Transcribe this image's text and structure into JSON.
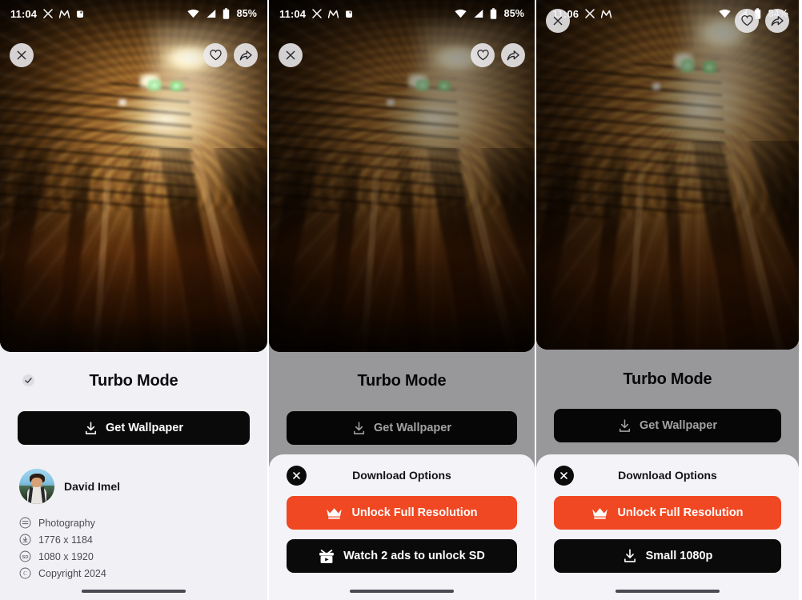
{
  "panels": [
    {
      "id": "panel-initial",
      "status": {
        "time": "11:04",
        "battery": "85%",
        "icons": [
          "x-app-icon",
          "monzo-icon",
          "app-badge-icon",
          "wifi-icon",
          "cellular-signal-icon",
          "battery-icon"
        ]
      },
      "top_actions": {
        "close": "close-icon",
        "favorite": "heart-icon",
        "share": "share-icon"
      },
      "wallpaper_title": "Turbo Mode",
      "get_wallpaper_label": "Get Wallpaper",
      "author": {
        "name": "David Imel",
        "verified": true
      },
      "meta": [
        {
          "icon": "category-icon",
          "text": "Photography"
        },
        {
          "icon": "resolution-icon",
          "text": "1776 x 1184"
        },
        {
          "icon": "sd-icon",
          "text": "1080 x 1920"
        },
        {
          "icon": "copyright-icon",
          "text": "Copyright 2024"
        }
      ],
      "sheet": null,
      "dimmed": false
    },
    {
      "id": "panel-download-options-ads",
      "status": {
        "time": "11:04",
        "battery": "85%",
        "icons": [
          "x-app-icon",
          "monzo-icon",
          "app-badge-icon",
          "wifi-icon",
          "cellular-signal-icon",
          "battery-icon"
        ]
      },
      "top_actions": {
        "close": "close-icon",
        "favorite": "heart-icon",
        "share": "share-icon"
      },
      "wallpaper_title": "Turbo Mode",
      "get_wallpaper_label": "Get Wallpaper",
      "dimmed": true,
      "sheet": {
        "title": "Download Options",
        "close_icon": "close-circle-icon",
        "options": [
          {
            "label": "Unlock Full Resolution",
            "icon": "crown-icon",
            "style": "primary"
          },
          {
            "label": "Watch 2 ads to unlock SD",
            "icon": "gift-video-icon",
            "style": "dark"
          }
        ]
      }
    },
    {
      "id": "panel-download-options-unlocked",
      "status": {
        "time": "11:06",
        "battery": "84%",
        "icons": [
          "x-app-icon",
          "monzo-icon",
          "wifi-icon",
          "cellular-signal-icon",
          "battery-icon"
        ]
      },
      "top_actions": {
        "close": "close-icon",
        "favorite": "heart-icon",
        "share": "share-icon"
      },
      "wallpaper_title": "Turbo Mode",
      "get_wallpaper_label": "Get Wallpaper",
      "dimmed": true,
      "sheet": {
        "title": "Download Options",
        "close_icon": "close-circle-icon",
        "options": [
          {
            "label": "Unlock Full Resolution",
            "icon": "crown-icon",
            "style": "primary"
          },
          {
            "label": "Small 1080p",
            "icon": "download-icon",
            "style": "dark"
          }
        ]
      }
    }
  ],
  "colors": {
    "accent": "#f04822",
    "button_dark": "#0a0a0a",
    "page_background": "#f1f1f5",
    "sheet_background": "#f4f4f8",
    "scrim": "rgba(0,0,0,0.37)",
    "text_primary": "#0c0c0f",
    "text_muted": "#4a4a52"
  }
}
